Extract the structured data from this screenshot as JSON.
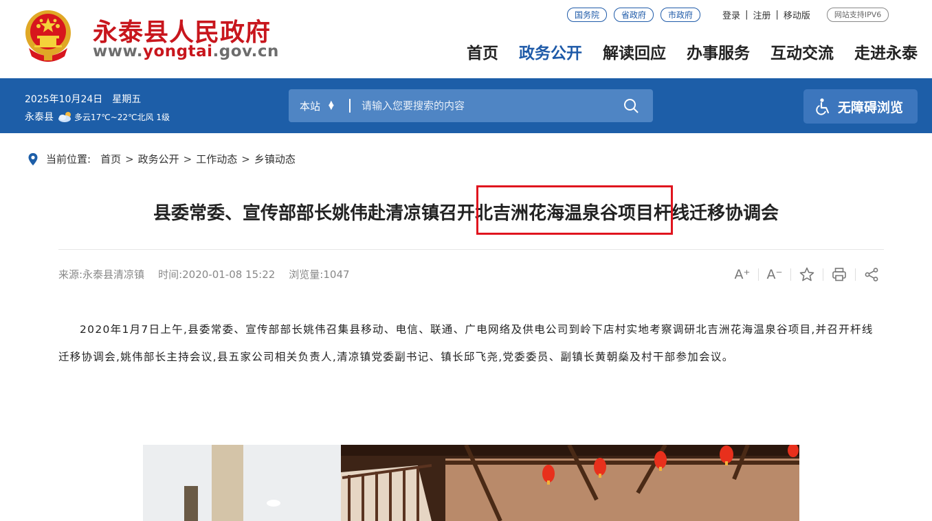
{
  "header": {
    "site_name": "永泰县人民政府",
    "url_prefix": "www.",
    "url_highlight": "yongtai",
    "url_suffix": ".gov.cn",
    "top_links": [
      "国务院",
      "省政府",
      "市政府"
    ],
    "account": {
      "login": "登录",
      "register": "注册",
      "mobile": "移动版"
    },
    "ipv6": "网站支持IPV6",
    "nav": [
      {
        "label": "首页",
        "active": false
      },
      {
        "label": "政务公开",
        "active": true
      },
      {
        "label": "解读回应",
        "active": false
      },
      {
        "label": "办事服务",
        "active": false
      },
      {
        "label": "互动交流",
        "active": false
      },
      {
        "label": "走进永泰",
        "active": false
      }
    ]
  },
  "infobar": {
    "date": "2025年10月24日",
    "weekday": "星期五",
    "location": "永泰县",
    "weather": "多云17℃~22℃北风 1级",
    "weather_icon": "cloud-sun-icon"
  },
  "search": {
    "scope": "本站",
    "placeholder": "请输入您要搜索的内容"
  },
  "accessibility": {
    "label": "无障碍浏览"
  },
  "breadcrumb": {
    "label": "当前位置:",
    "items": [
      "首页",
      "政务公开",
      "工作动态",
      "乡镇动态"
    ]
  },
  "article": {
    "title": "县委常委、宣传部部长姚伟赴清凉镇召开北吉洲花海温泉谷项目杆线迁移协调会",
    "source": "来源:永泰县清凉镇",
    "time": "时间:2020-01-08 15:22",
    "views": "浏览量:1047",
    "tools": {
      "font_larger": "A⁺",
      "font_smaller": "A⁻"
    },
    "body": "2020年1月7日上午,县委常委、宣传部部长姚伟召集县移动、电信、联通、广电网络及供电公司到岭下店村实地考察调研北吉洲花海温泉谷项目,并召开杆线迁移协调会,姚伟部长主持会议,县五家公司相关负责人,清凉镇党委副书记、镇长邱飞尧,党委委员、副镇长黄朝燊及村干部参加会议。"
  },
  "colors": {
    "brand_red": "#c8161d",
    "brand_blue": "#1d5ea8",
    "highlight_box": "#e0141e"
  }
}
